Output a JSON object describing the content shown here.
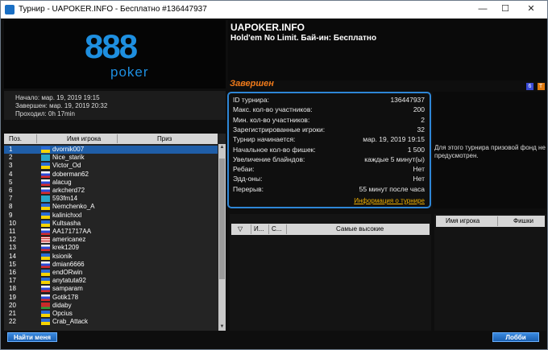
{
  "window": {
    "title": "Турнир - UAPOKER.INFO - Бесплатно #136447937",
    "minimize": "—",
    "maximize": "☐",
    "close": "✕"
  },
  "logo": {
    "main": "888",
    "sub": "poker"
  },
  "header": {
    "site": "UAPOKER.INFO",
    "game": "Hold'em No Limit. Бай-ин: Бесплатно"
  },
  "dates": {
    "start": "Начало: мар. 19, 2019 19:15",
    "end": "Завершен: мар. 19, 2019 20:32",
    "duration": "Проходил: 0h 17min"
  },
  "status": "Завершен",
  "status_icons": [
    {
      "label": "6",
      "color": "#3a4bd6"
    },
    {
      "label": "T",
      "color": "#e07a10"
    }
  ],
  "info": {
    "rows": [
      {
        "k": "ID турнира:",
        "v": "136447937"
      },
      {
        "k": "Макс. кол-во участников:",
        "v": "200"
      },
      {
        "k": "Мин. кол-во участников:",
        "v": "2"
      },
      {
        "k": "Зарегистрированные игроки:",
        "v": "32"
      },
      {
        "k": "Турнир начинается:",
        "v": "мар. 19, 2019 19:15"
      },
      {
        "k": "Начальное кол-во фишек:",
        "v": "1 500"
      },
      {
        "k": "Увеличение блайндов:",
        "v": "каждые 5 минут(ы)"
      },
      {
        "k": "Ребаи:",
        "v": "Нет"
      },
      {
        "k": "Эдд-оны:",
        "v": "Нет"
      },
      {
        "k": "Перерыв:",
        "v": "55 минут после часа"
      }
    ],
    "link": "Информация о турнире"
  },
  "prize_text": "Для этого турнира призовой фонд не предусмотрен.",
  "players": {
    "headers": [
      "Поз.",
      "Имя игрока",
      "Приз"
    ],
    "rows": [
      {
        "pos": "1",
        "name": "dvornik007",
        "flag": "ua"
      },
      {
        "pos": "2",
        "name": "Nice_starik",
        "flag": "kz"
      },
      {
        "pos": "3",
        "name": "Victor_Od",
        "flag": "ua"
      },
      {
        "pos": "4",
        "name": "doberman62",
        "flag": "ru"
      },
      {
        "pos": "5",
        "name": "alacug",
        "flag": "ru"
      },
      {
        "pos": "6",
        "name": "arkcherd72",
        "flag": "ru"
      },
      {
        "pos": "7",
        "name": "593fm14",
        "flag": "kz"
      },
      {
        "pos": "8",
        "name": "Nemchenko_A",
        "flag": "ua"
      },
      {
        "pos": "9",
        "name": "kalinichxxl",
        "flag": "ua"
      },
      {
        "pos": "10",
        "name": "Kultsasha",
        "flag": "ua"
      },
      {
        "pos": "11",
        "name": "AA171717AA",
        "flag": "ru"
      },
      {
        "pos": "12",
        "name": "americanez",
        "flag": "us"
      },
      {
        "pos": "13",
        "name": "krek1209",
        "flag": "ru"
      },
      {
        "pos": "14",
        "name": "ksionik",
        "flag": "ua"
      },
      {
        "pos": "15",
        "name": "dmian6666",
        "flag": "ru"
      },
      {
        "pos": "16",
        "name": "endORwin",
        "flag": "ua"
      },
      {
        "pos": "17",
        "name": "anytatuta92",
        "flag": "ua"
      },
      {
        "pos": "18",
        "name": "samparam",
        "flag": "ru"
      },
      {
        "pos": "19",
        "name": "Gotik178",
        "flag": "ru"
      },
      {
        "pos": "20",
        "name": "didaby",
        "flag": "by"
      },
      {
        "pos": "21",
        "name": "Opcius",
        "flag": "ua"
      },
      {
        "pos": "22",
        "name": "Crab_Attack",
        "flag": "ua"
      }
    ]
  },
  "blinds": {
    "headers": [
      "▽",
      "И...",
      "С...",
      "Самые высокие"
    ]
  },
  "tables": {
    "headers": [
      "Имя игрока",
      "Фишки"
    ]
  },
  "buttons": {
    "find_me": "Найти меня",
    "lobby": "Лобби"
  },
  "colors": {
    "accent": "#2e86d6",
    "status": "#f07a1a",
    "link": "#f0b000",
    "selected": "#1f5ea8"
  }
}
